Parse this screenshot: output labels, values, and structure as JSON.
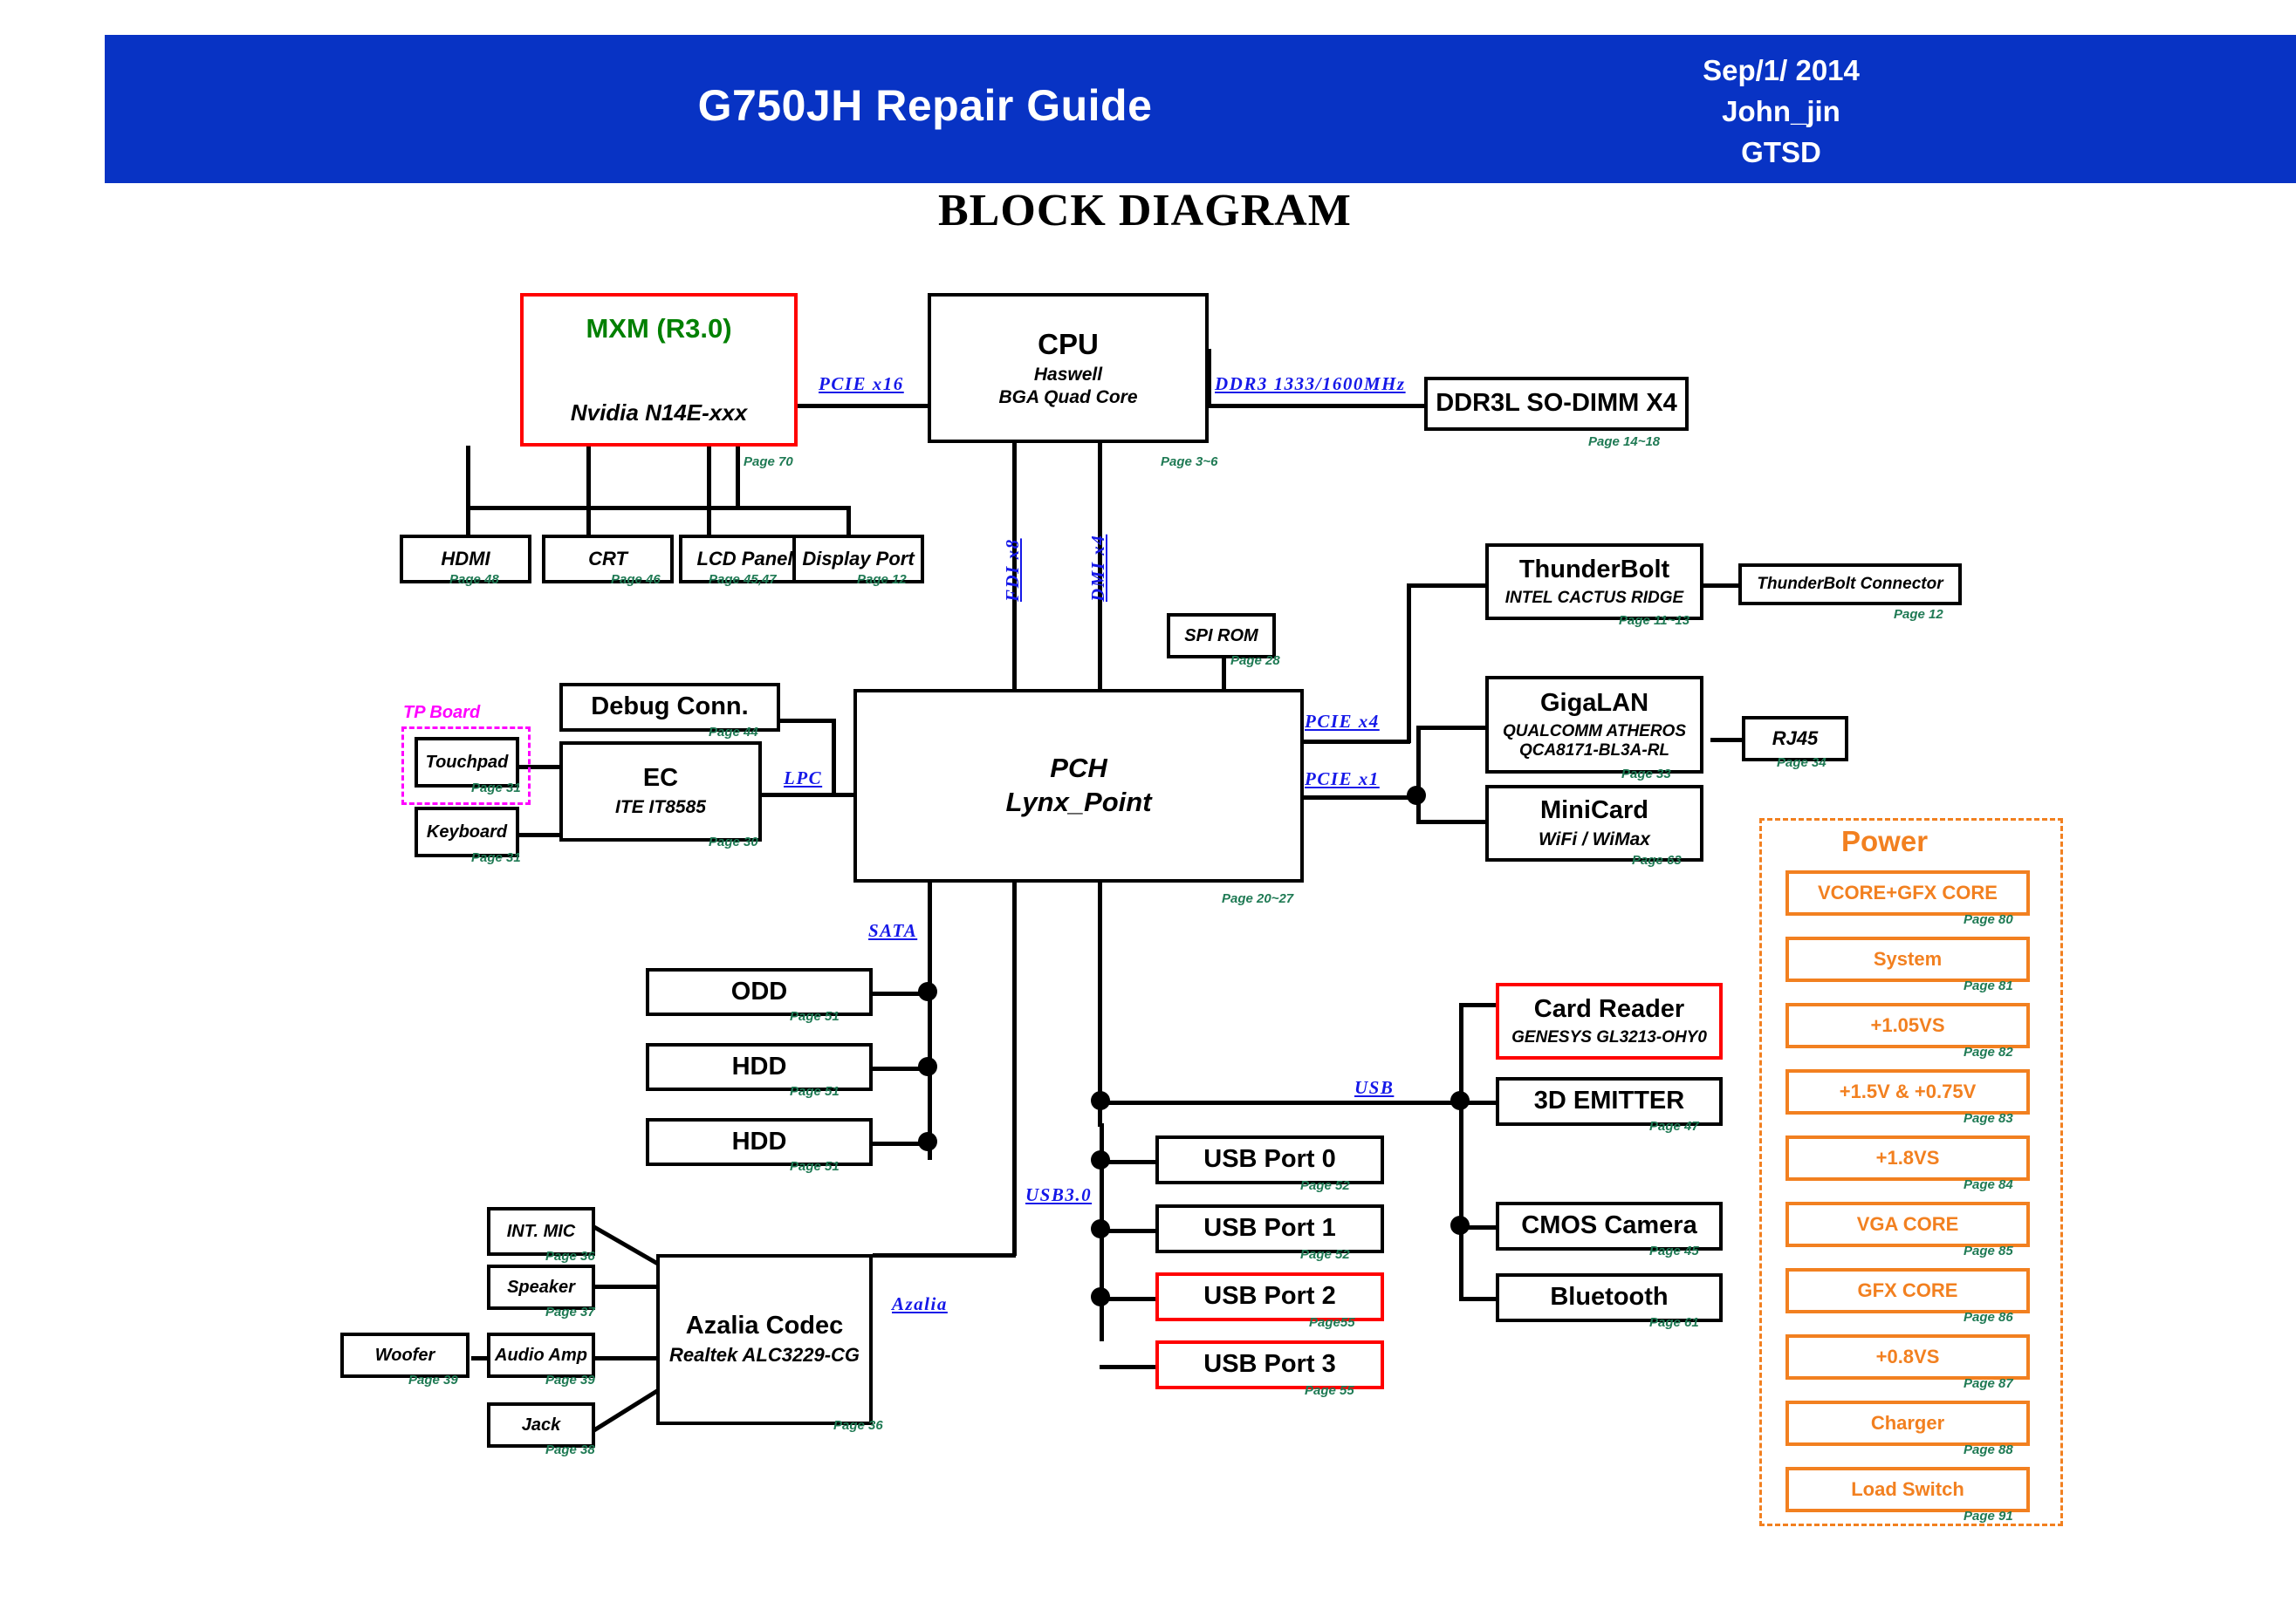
{
  "header": {
    "title": "G750JH Repair Guide",
    "date": "Sep/1/ 2014",
    "author": "John_jin",
    "dept": "GTSD",
    "bg_color": "#0833C4"
  },
  "page_title": "BLOCK DIAGRAM",
  "blocks": {
    "mxm": {
      "title": "MXM (R3.0)",
      "sub": "Nvidia N14E-xxx",
      "page": "Page 70",
      "border": "#FF0000",
      "title_color": "#008000"
    },
    "cpu": {
      "title": "CPU",
      "sub1": "Haswell",
      "sub2": "BGA Quad Core",
      "page": "Page 3~6"
    },
    "ddr": {
      "title": "DDR3L SO-DIMM X4",
      "page": "Page 14~18"
    },
    "hdmi": {
      "title": "HDMI",
      "page": "Page 48"
    },
    "crt": {
      "title": "CRT",
      "page": "Page 46"
    },
    "lcd": {
      "title": "LCD Panel",
      "page": "Page 45,47"
    },
    "dp": {
      "title": "Display Port",
      "page": "Page 12"
    },
    "thunderbolt": {
      "title": "ThunderBolt",
      "sub": "INTEL CACTUS  RIDGE",
      "page": "Page 11~13"
    },
    "tb_conn": {
      "title": "ThunderBolt Connector",
      "page": "Page 12"
    },
    "spirom": {
      "title": "SPI ROM",
      "page": "Page 28"
    },
    "gigalan": {
      "title": "GigaLAN",
      "sub1": "QUALCOMM ATHEROS",
      "sub2": "QCA8171-BL3A-RL",
      "page": "Page 33"
    },
    "rj45": {
      "title": "RJ45",
      "page": "Page 34"
    },
    "minicard": {
      "title": "MiniCard",
      "sub": "WiFi / WiMax",
      "page": "Page 63"
    },
    "pch": {
      "title1": "PCH",
      "title2": "Lynx_Point",
      "page": "Page 20~27"
    },
    "debug": {
      "title": "Debug Conn.",
      "page": "Page 44"
    },
    "ec": {
      "title": "EC",
      "sub": "ITE IT8585",
      "page": "Page 30"
    },
    "touchpad": {
      "title": "Touchpad",
      "page": "Page 31"
    },
    "keyboard": {
      "title": "Keyboard",
      "page": "Page 31"
    },
    "odd": {
      "title": "ODD",
      "page": "Page 51"
    },
    "hdd1": {
      "title": "HDD",
      "page": "Page 51"
    },
    "hdd2": {
      "title": "HDD",
      "page": "Page 51"
    },
    "usb0": {
      "title": "USB Port 0",
      "page": "Page 52"
    },
    "usb1": {
      "title": "USB Port 1",
      "page": "Page 52"
    },
    "usb2": {
      "title": "USB Port 2",
      "page": "Page55",
      "border": "#FF0000"
    },
    "usb3": {
      "title": "USB Port 3",
      "page": "Page 55",
      "border": "#FF0000"
    },
    "cardreader": {
      "title": "Card Reader",
      "sub": "GENESYS GL3213-OHY0",
      "border": "#FF0000"
    },
    "emitter": {
      "title": "3D EMITTER",
      "page": "Page 47"
    },
    "cmos": {
      "title": "CMOS Camera",
      "page": "Page 45"
    },
    "bluetooth": {
      "title": "Bluetooth",
      "page": "Page 61"
    },
    "codec": {
      "title": "Azalia Codec",
      "sub": "Realtek ALC3229-CG",
      "page": "Page 36"
    },
    "intmic": {
      "title": "INT. MIC",
      "page": "Page 36"
    },
    "speaker": {
      "title": "Speaker",
      "page": "Page 37"
    },
    "audioamp": {
      "title": "Audio Amp",
      "page": "Page 39"
    },
    "woofer": {
      "title": "Woofer",
      "page": "Page 39"
    },
    "jack": {
      "title": "Jack",
      "page": "Page 38"
    }
  },
  "groups": {
    "tp_board": {
      "label": "TP Board",
      "color": "#FF00FF"
    },
    "power": {
      "label": "Power",
      "color": "#F28020"
    }
  },
  "bus_labels": {
    "pcie_x16": "PCIE  x16",
    "ddr3": "DDR3  1333/1600MHz",
    "fdi_x8": "FDI  x8",
    "dmi_x4": "DMI  x4",
    "pcie_x4": "PCIE  x4",
    "pcie_x1": "PCIE  x1",
    "lpc": "LPC",
    "sata": "SATA",
    "usb3": "USB3.0",
    "usb": "USB",
    "azalia": "Azalia",
    "color": "#1518E8"
  },
  "power_rails": [
    {
      "label": "VCORE+GFX CORE",
      "page": "Page 80"
    },
    {
      "label": "System",
      "page": "Page 81"
    },
    {
      "label": "+1.05VS",
      "page": "Page 82"
    },
    {
      "label": "+1.5V & +0.75V",
      "page": "Page 83"
    },
    {
      "label": "+1.8VS",
      "page": "Page 84"
    },
    {
      "label": "VGA CORE",
      "page": "Page 85"
    },
    {
      "label": "GFX CORE",
      "page": "Page 86"
    },
    {
      "label": "+0.8VS",
      "page": "Page 87"
    },
    {
      "label": "Charger",
      "page": "Page 88"
    },
    {
      "label": "Load Switch",
      "page": "Page 91"
    }
  ]
}
